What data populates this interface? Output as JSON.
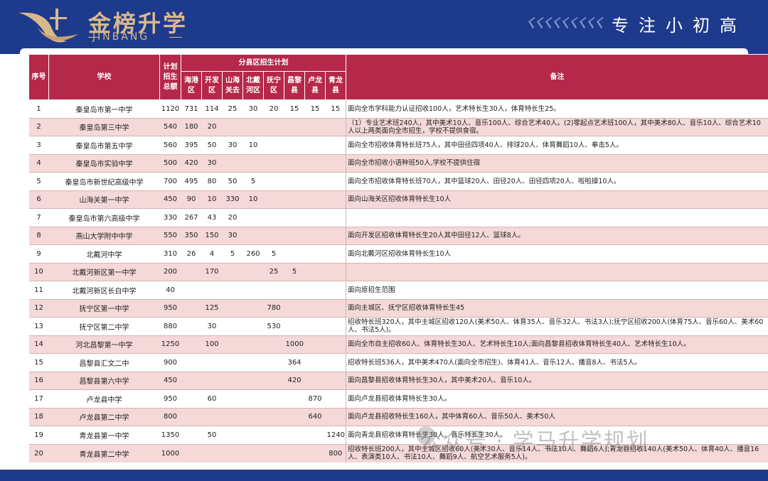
{
  "header": {
    "logo_cn": "金榜升学",
    "logo_en": "JINBANG",
    "slogan": "专注小初高"
  },
  "table": {
    "headers": {
      "seq": "序号",
      "school": "学校",
      "total": "计划招生总额",
      "district_group": "分县区招生计划",
      "remark": "备注",
      "districts": [
        "海港区",
        "开发区",
        "山海关去",
        "北戴河区",
        "抚宁区",
        "昌黎县",
        "卢龙县",
        "青龙县"
      ]
    },
    "rows": [
      {
        "seq": "1",
        "school": "秦皇岛市第一中学",
        "total": "1120",
        "d": [
          "731",
          "114",
          "25",
          "30",
          "20",
          "15",
          "15",
          "15"
        ],
        "note": "面向全市学科能力认证招收100人，艺术特长生30人，体育特长生25。"
      },
      {
        "seq": "2",
        "school": "秦皇岛第三中学",
        "total": "540",
        "d": [
          "180",
          "20",
          "",
          "",
          "",
          "",
          "",
          ""
        ],
        "note": "（1）专业艺术班240人，其中美术10人、音乐100人、综合艺术40人。(2)零起点艺术班100人，其中美术80人、音乐10人、综合艺术10人以上两类面向全市招生，学校不提供食宿。"
      },
      {
        "seq": "3",
        "school": "秦皇岛市第五中学",
        "total": "560",
        "d": [
          "395",
          "50",
          "30",
          "10",
          "",
          "",
          "",
          ""
        ],
        "note": "面向全市招收体育特长班75人，其中田径四项40人、排球20人、体育舞蹈10人、拳击5人。"
      },
      {
        "seq": "4",
        "school": "秦皇岛市实验中学",
        "total": "500",
        "d": [
          "420",
          "30",
          "",
          "",
          "",
          "",
          "",
          ""
        ],
        "note": "面向全市招收小语种班50人,学校不提供住宿"
      },
      {
        "seq": "5",
        "school": "秦皇岛市新世纪高级中学",
        "total": "700",
        "d": [
          "495",
          "80",
          "50",
          "5",
          "",
          "",
          "",
          ""
        ],
        "note": "面向全市招收体育特长班70人，其中篮球20人、田径20人、田径四项20人、啦啦操10人。"
      },
      {
        "seq": "6",
        "school": "山海关第一中学",
        "total": "450",
        "d": [
          "90",
          "10",
          "330",
          "10",
          "",
          "",
          "",
          ""
        ],
        "note": "面向山海关区招收体育特长生10人"
      },
      {
        "seq": "7",
        "school": "秦皇岛市第六高级中学",
        "total": "330",
        "d": [
          "267",
          "43",
          "20",
          "",
          "",
          "",
          "",
          ""
        ],
        "note": ""
      },
      {
        "seq": "8",
        "school": "燕山大学附中中学",
        "total": "550",
        "d": [
          "350",
          "150",
          "30",
          "",
          "",
          "",
          "",
          ""
        ],
        "note": "面向开发区招收体育特长生20人其中田径12人、篮球8人。"
      },
      {
        "seq": "9",
        "school": "北戴河中学",
        "total": "310",
        "d": [
          "26",
          "4",
          "5",
          "260",
          "5",
          "",
          "",
          ""
        ],
        "note": "面向北戴河区招收体育特长生10人"
      },
      {
        "seq": "10",
        "school": "北戴河新区第一中学",
        "total": "200",
        "d": [
          "",
          "170",
          "",
          "",
          "25",
          "5",
          "",
          ""
        ],
        "note": ""
      },
      {
        "seq": "11",
        "school": "北戴河新区长白中学",
        "total": "40",
        "d": [
          "",
          "",
          "",
          "",
          "",
          "",
          "",
          ""
        ],
        "note": "面向原招生范围"
      },
      {
        "seq": "12",
        "school": "抚宁区第一中学",
        "total": "950",
        "d": [
          "",
          "125",
          "",
          "",
          "780",
          "",
          "",
          ""
        ],
        "note": "面向主城区、抚宁区招收体育特长生45"
      },
      {
        "seq": "13",
        "school": "抚宁区第二中学",
        "total": "880",
        "d": [
          "",
          "30",
          "",
          "",
          "530",
          "",
          "",
          ""
        ],
        "note": "招收特长班320人，其中主城区招收120人(美术50人、体育35人、音乐32人、书法3人);抚宁区招收200人(体育75人、音乐60人、美术60人、书法5人)。"
      },
      {
        "seq": "14",
        "school": "河北昌黎第一中学",
        "total": "1250",
        "d": [
          "",
          "100",
          "",
          "",
          "",
          "1000",
          "",
          ""
        ],
        "note": "面向全市自主招收60人、体育特长生30人、艺术特长生10人;面向昌黎县招收体育特长生40人、艺术特长生10人。"
      },
      {
        "seq": "15",
        "school": "昌黎县汇文二中",
        "total": "900",
        "d": [
          "",
          "",
          "",
          "",
          "",
          "364",
          "",
          ""
        ],
        "note": "招收特长班536人，其中美术470人(面向全市招生)、体育41人、音乐12人、播音8人、书法5人。"
      },
      {
        "seq": "16",
        "school": "昌黎县第六中学",
        "total": "450",
        "d": [
          "",
          "",
          "",
          "",
          "",
          "420",
          "",
          ""
        ],
        "note": "面向昌黎县招收体育特长生30人，其中美术20人、音乐10人。"
      },
      {
        "seq": "17",
        "school": "卢龙县中学",
        "total": "950",
        "d": [
          "",
          "60",
          "",
          "",
          "",
          "",
          "870",
          ""
        ],
        "note": "面向卢龙县招收体育特长生30人。"
      },
      {
        "seq": "18",
        "school": "卢龙县第二中学",
        "total": "800",
        "d": [
          "",
          "",
          "",
          "",
          "",
          "",
          "640",
          ""
        ],
        "note": "面向卢龙县招收特长生160人，其中体育60人、音乐50人、美术50人"
      },
      {
        "seq": "19",
        "school": "青龙县第一中学",
        "total": "1350",
        "d": [
          "",
          "50",
          "",
          "",
          "",
          "",
          "",
          "1240"
        ],
        "note": "面向青龙县招收体育特长生30人、音乐特长生30人。"
      },
      {
        "seq": "20",
        "school": "青龙县第二中学",
        "total": "1000",
        "d": [
          "",
          "",
          "",
          "",
          "",
          "",
          "",
          "800"
        ],
        "note": "招收特长班200人，其中主城区招收60人(美术30人、音乐14人、书法10人、舞蹈6人);青龙县招收140人(美术50人、体育40人、播音16人、表演类10人、书法10人、舞蹈9人、航空艺术服务5人)。"
      }
    ]
  },
  "watermark": "公众号 · 学马升学规划",
  "colors": {
    "brand_blue": "#1e3a8c",
    "header_red": "#b5284a",
    "row_pink": "#f5d8d8",
    "gold": "#d9b98a"
  }
}
